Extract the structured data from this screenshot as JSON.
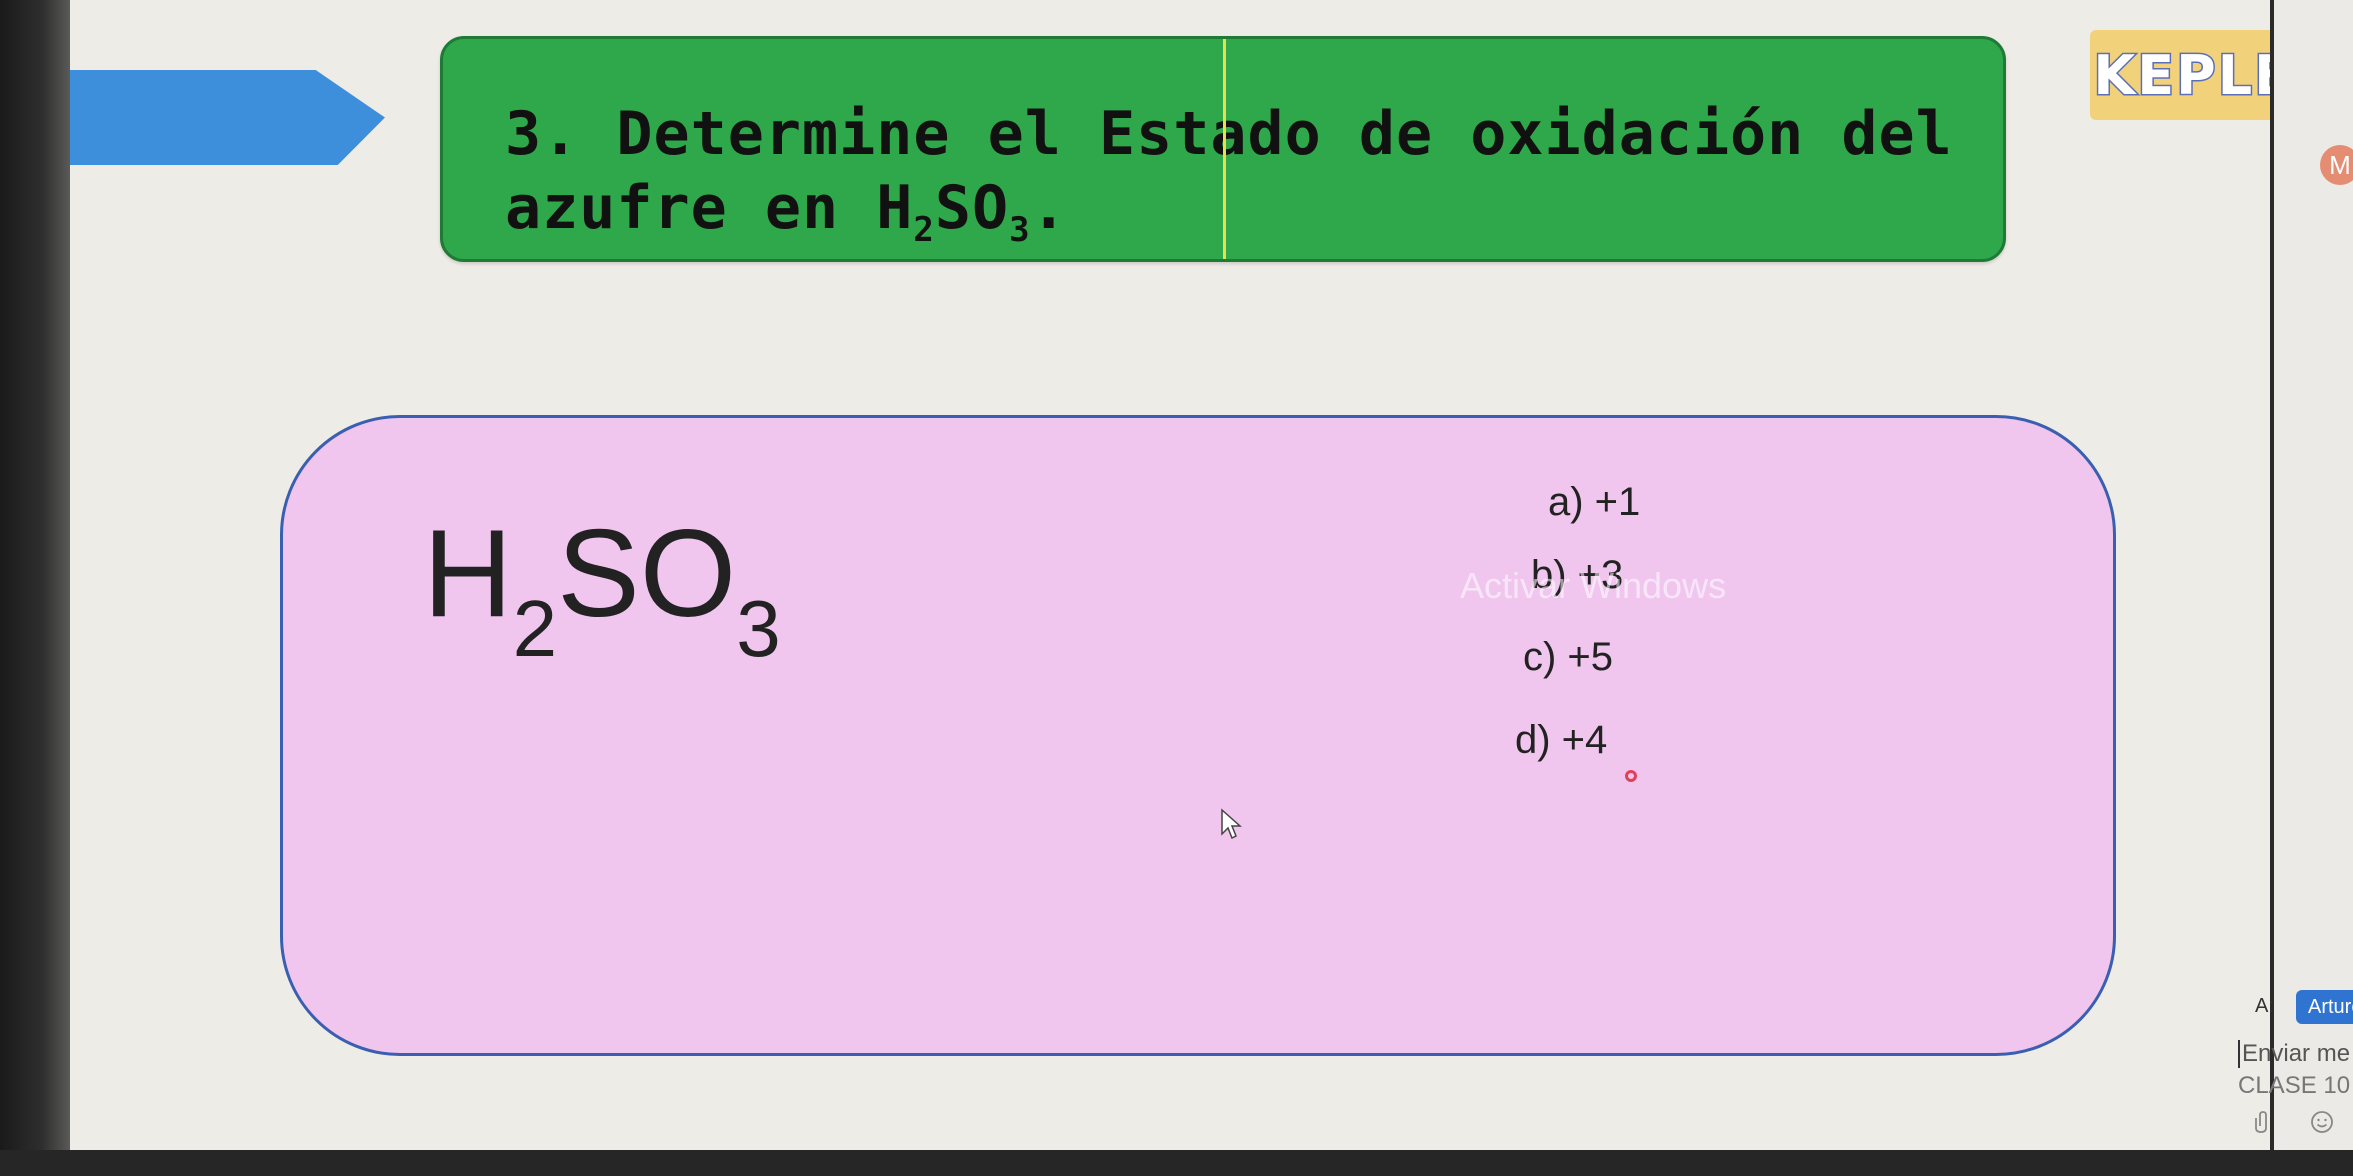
{
  "slide": {
    "question_prefix": "3. Determine el Estado de oxidación del azufre en ",
    "question_formula_h": "H",
    "question_formula_h_sub": "2",
    "question_formula_so": "SO",
    "question_formula_so_sub": "3",
    "question_suffix": ".",
    "logo_text": "KEPLER",
    "formula": {
      "h": "H",
      "h_sub": "2",
      "so": "SO",
      "so_sub": "3"
    },
    "options": [
      {
        "label": "a)  +1"
      },
      {
        "label": "b) +3"
      },
      {
        "label": "c) +5"
      },
      {
        "label": "d) +4"
      }
    ],
    "watermark": "Activar Windows"
  },
  "chat": {
    "avatar_letter": "M",
    "to_label": "A:",
    "recipient": "Arturo",
    "message_placeholder": "Enviar me",
    "class_label": "CLASE 10"
  },
  "colors": {
    "title_green": "#2fa84b",
    "answer_pink": "#f0c6ef",
    "arrow_blue": "#3d8fdc",
    "chip_blue": "#2f74d0"
  }
}
